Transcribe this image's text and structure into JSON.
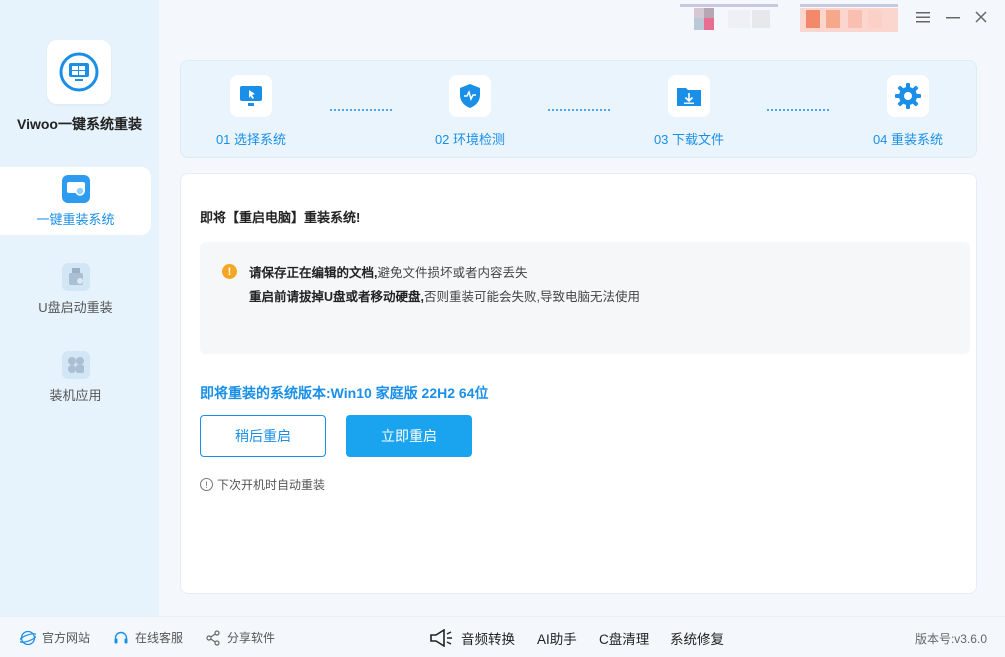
{
  "app": {
    "name": "Viwoo一键系统重装"
  },
  "sidebar": {
    "items": [
      {
        "label": "一键重装系统",
        "icon": "monitor-reinstall-icon",
        "active": true
      },
      {
        "label": "U盘启动重装",
        "icon": "usb-drive-icon",
        "active": false
      },
      {
        "label": "装机应用",
        "icon": "apps-grid-icon",
        "active": false
      }
    ]
  },
  "steps": [
    {
      "label": "01 选择系统",
      "icon": "monitor-cursor-icon"
    },
    {
      "label": "02 环境检测",
      "icon": "shield-check-icon"
    },
    {
      "label": "03 下载文件",
      "icon": "folder-download-icon"
    },
    {
      "label": "04 重装系统",
      "icon": "gear-icon"
    }
  ],
  "main": {
    "heading": "即将【重启电脑】重装系统!",
    "notice": {
      "line1_bold": "请保存正在编辑的文档,",
      "line1_rest": "避免文件损坏或者内容丢失",
      "line2_bold": "重启前请拔掉U盘或者移动硬盘,",
      "line2_rest": "否则重装可能会失败,导致电脑无法使用"
    },
    "version_label": "即将重装的系统版本:",
    "version_value": "Win10 家庭版 22H2 64位",
    "btn_later": "稍后重启",
    "btn_now": "立即重启",
    "hint": "下次开机时自动重装"
  },
  "footer": {
    "official_site": "官方网站",
    "support": "在线客服",
    "share": "分享软件",
    "audio_convert": "音频转换",
    "ai_helper": "AI助手",
    "c_clean": "C盘清理",
    "sys_repair": "系统修复",
    "version": "版本号:v3.6.0"
  },
  "colors": {
    "accent": "#1a8fe8",
    "primary_btn": "#1aa3ee",
    "warning": "#f5a623"
  }
}
